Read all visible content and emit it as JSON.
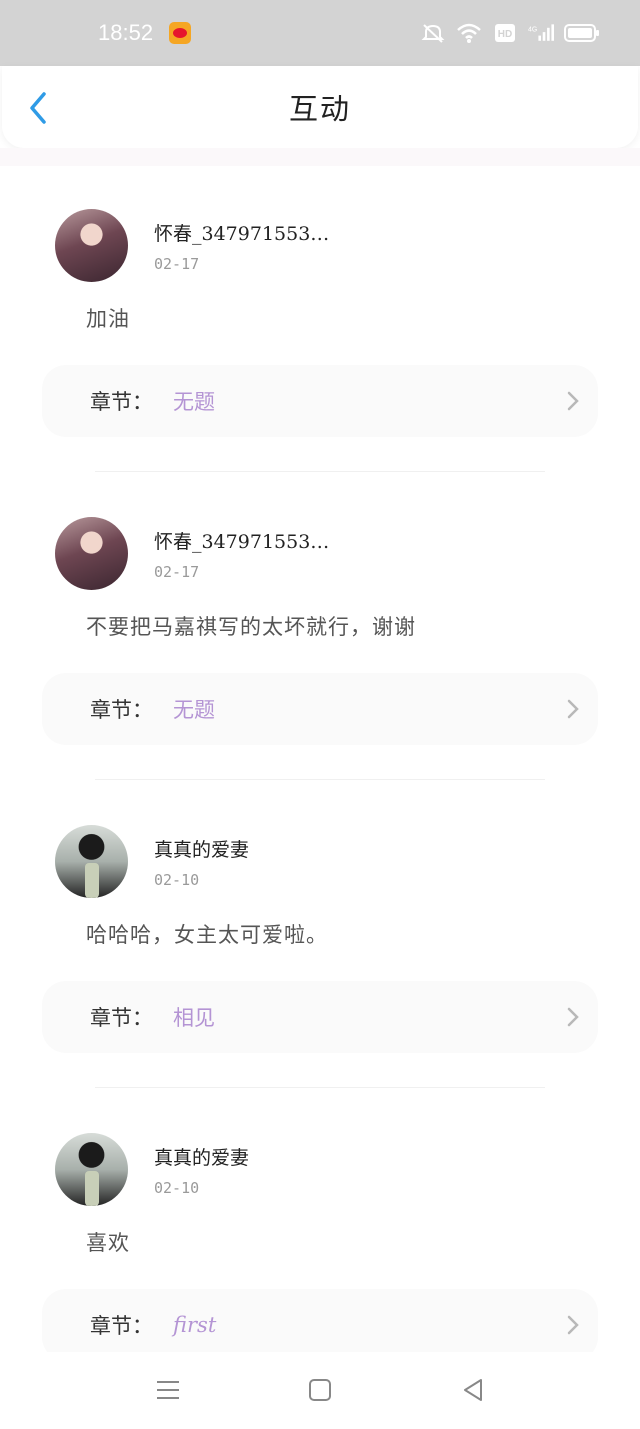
{
  "status_bar": {
    "time": "18:52",
    "app_icon": "weibo-icon",
    "icons": [
      "mute-icon",
      "wifi-icon",
      "hd-icon",
      "4g-signal-icon",
      "battery-icon"
    ]
  },
  "header": {
    "title": "互动",
    "back_icon": "chevron-left-icon",
    "accent_color": "#2f9be6"
  },
  "comments": [
    {
      "username": "怀春_347971553…",
      "date": "02-17",
      "text": "加油",
      "chapter_label": "章节：",
      "chapter_name": "无题",
      "avatar": "female"
    },
    {
      "username": "怀春_347971553…",
      "date": "02-17",
      "text": "不要把马嘉祺写的太坏就行，谢谢",
      "chapter_label": "章节：",
      "chapter_name": "无题",
      "avatar": "female"
    },
    {
      "username": "真真的爱妻",
      "date": "02-10",
      "text": "哈哈哈，女主太可爱啦。",
      "chapter_label": "章节：",
      "chapter_name": "相见",
      "avatar": "male"
    },
    {
      "username": "真真的爱妻",
      "date": "02-10",
      "text": "喜欢",
      "chapter_label": "章节：",
      "chapter_name": "first",
      "avatar": "male"
    }
  ],
  "colors": {
    "chapter_name": "#b494d4",
    "date": "#9a9a9a"
  },
  "nav": {
    "icons": [
      "menu-icon",
      "home-square-icon",
      "back-triangle-icon"
    ]
  }
}
